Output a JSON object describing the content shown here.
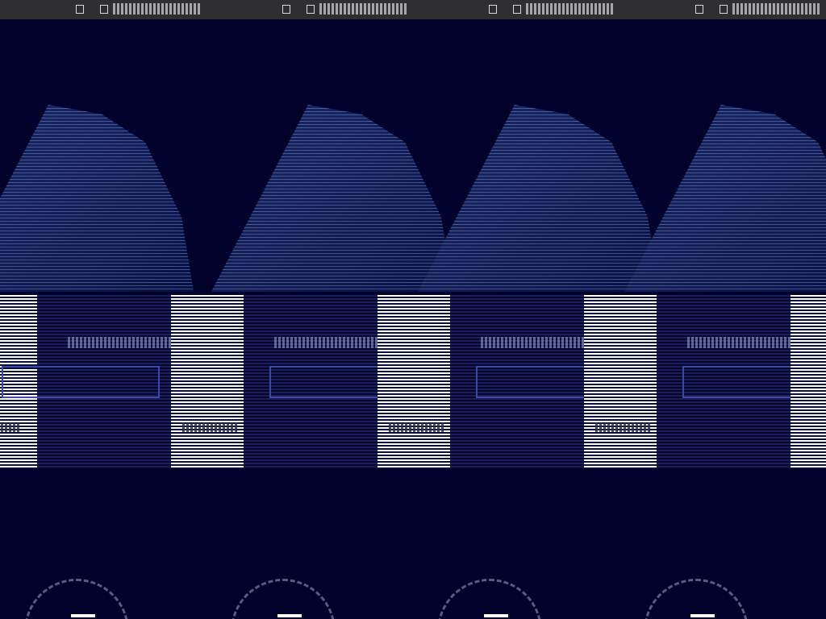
{
  "topbar": {
    "segments": [
      {
        "id": "seg-1"
      },
      {
        "id": "seg-2"
      },
      {
        "id": "seg-3"
      },
      {
        "id": "seg-4"
      }
    ]
  },
  "colors": {
    "background": "#00012a",
    "topbar": "#2e2e33",
    "panel_field_border": "#3a4aa8"
  },
  "icons": {
    "topbar_icon": "window-icon"
  }
}
